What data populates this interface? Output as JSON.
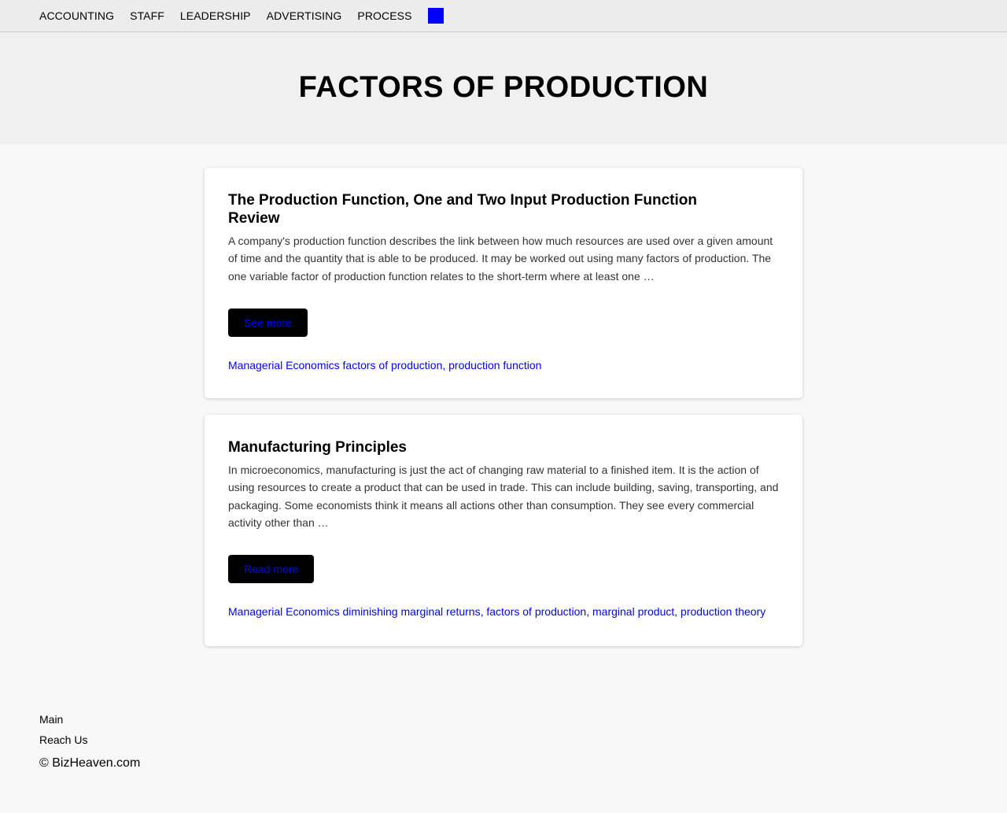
{
  "nav": {
    "items": [
      {
        "label": "ACCOUNTING"
      },
      {
        "label": "STAFF"
      },
      {
        "label": "LEADERSHIP"
      },
      {
        "label": "ADVERTISING"
      },
      {
        "label": "PROCESS"
      }
    ],
    "menu_square_color": "#0000ff"
  },
  "hero": {
    "title": "FACTORS OF PRODUCTION"
  },
  "articles": [
    {
      "title": "The Production Function, One and Two Input Production Function Review",
      "excerpt": "A company's production function describes the link between how much resources are used over a given amount of time and the quantity that is able to be produced. It may be worked out using many factors of production. The one variable factor of production function relates to the short-term where at least one …",
      "button_label": "See more",
      "category": "Managerial Economics",
      "tags": "factors of production, production function"
    },
    {
      "title": "Manufacturing Principles",
      "excerpt": "In microeconomics, manufacturing is just the act of changing raw material to a finished item. It is the action of using resources to create a product that can be used in trade. This can include building, saving, transporting, and packaging. Some economists think it means all actions other than consumption. They see every commercial activity other than …",
      "button_label": "Read more",
      "category": "Managerial Economics",
      "tags": "diminishing marginal returns, factors of production, marginal product, production theory"
    }
  ],
  "footer": {
    "links": [
      {
        "label": "Main"
      },
      {
        "label": "Reach Us"
      }
    ],
    "copyright": "© BizHeaven.com"
  },
  "colors": {
    "link": "#0000ff",
    "button_bg": "#000000",
    "nav_bg": "#ececec",
    "hero_bg": "#f0f0f0",
    "page_bg": "#f8f8f8"
  }
}
